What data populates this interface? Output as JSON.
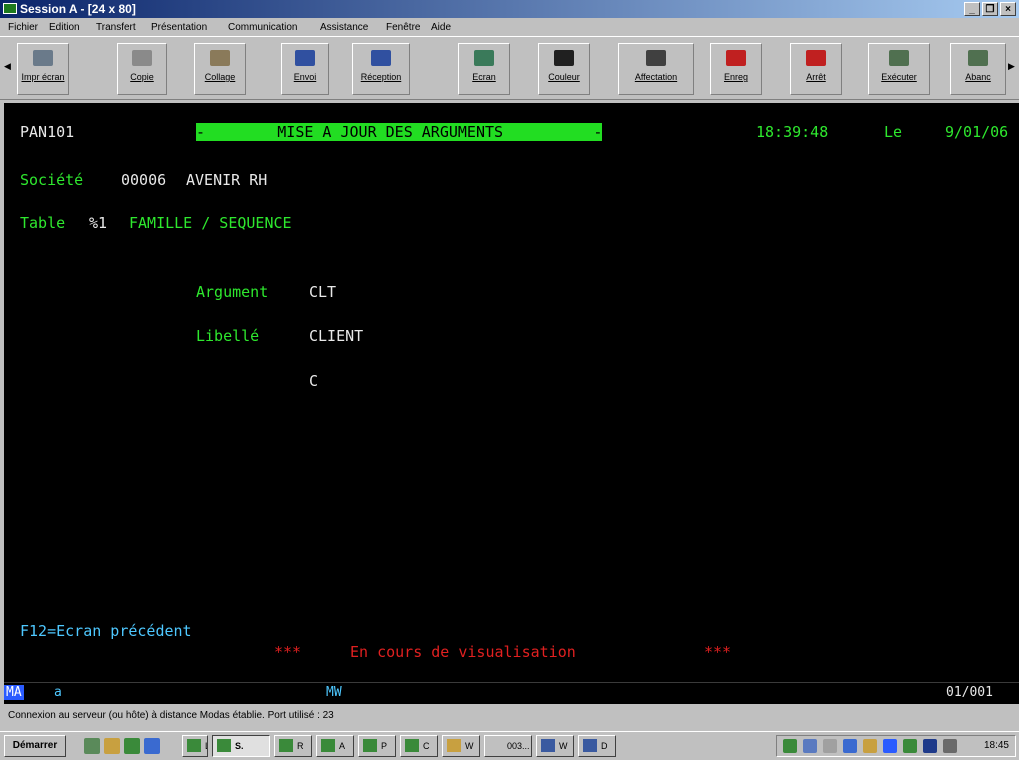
{
  "window": {
    "title": "Session A - [24 x 80]",
    "controls": [
      "_",
      "❐",
      "×"
    ]
  },
  "menu": [
    "Fichier",
    "Edition",
    "Transfert",
    "Présentation",
    "Communication",
    "Assistance",
    "Fenêtre",
    "Aide"
  ],
  "toolbar": {
    "buttons": [
      {
        "label": "Impr écran",
        "icon": "print-screen-icon",
        "color": "#6a7a8a"
      },
      {
        "label": "Copie",
        "icon": "copy-icon",
        "color": "#8a8a8a"
      },
      {
        "label": "Collage",
        "icon": "paste-icon",
        "color": "#8a7a5a"
      },
      {
        "label": "Envoi",
        "icon": "send-icon",
        "color": "#3050a0"
      },
      {
        "label": "Réception",
        "icon": "receive-icon",
        "color": "#3050a0"
      },
      {
        "label": "Ecran",
        "icon": "screen-icon",
        "color": "#3a7a5a"
      },
      {
        "label": "Couleur",
        "icon": "color-icon",
        "color": "#202020"
      },
      {
        "label": "Affectation",
        "icon": "keyboard-map-icon",
        "color": "#404040"
      },
      {
        "label": "Enreg",
        "icon": "record-icon",
        "color": "#c02020"
      },
      {
        "label": "Arrêt",
        "icon": "stop-icon",
        "color": "#c02020"
      },
      {
        "label": "Exécuter",
        "icon": "run-icon",
        "color": "#507050"
      },
      {
        "label": "Abanc",
        "icon": "abandon-icon",
        "color": "#507050"
      }
    ]
  },
  "screen": {
    "program": "PAN101",
    "title": "-        MISE A JOUR DES ARGUMENTS          -",
    "time": "18:39:48",
    "date_label": "Le",
    "date": "9/01/06",
    "societe_label": "Société",
    "societe_code": "00006",
    "societe_name": "AVENIR RH",
    "table_label": "Table",
    "table_code": "%1",
    "table_name": "FAMILLE / SEQUENCE",
    "argument_label": "Argument",
    "argument_value": "CLT",
    "libelle_label": "Libellé",
    "libelle_value": "CLIENT",
    "code_value": "C",
    "fkey": "F12=Ecran précédent",
    "mode_stars_left": "***",
    "mode_text": "En cours de visualisation",
    "mode_stars_right": "***"
  },
  "oia": {
    "ma": "MA",
    "a": "a",
    "mw": "MW",
    "cursor": "01/001"
  },
  "statusbar": "Connexion au serveur (ou hôte) à distance Modas établie. Port utilisé : 23",
  "taskbar": {
    "start": "Démarrer",
    "tasks": [
      "L",
      "S.",
      "R",
      "A",
      "P",
      "C",
      "W",
      "003...",
      "W",
      "D"
    ],
    "clock": "18:45"
  }
}
